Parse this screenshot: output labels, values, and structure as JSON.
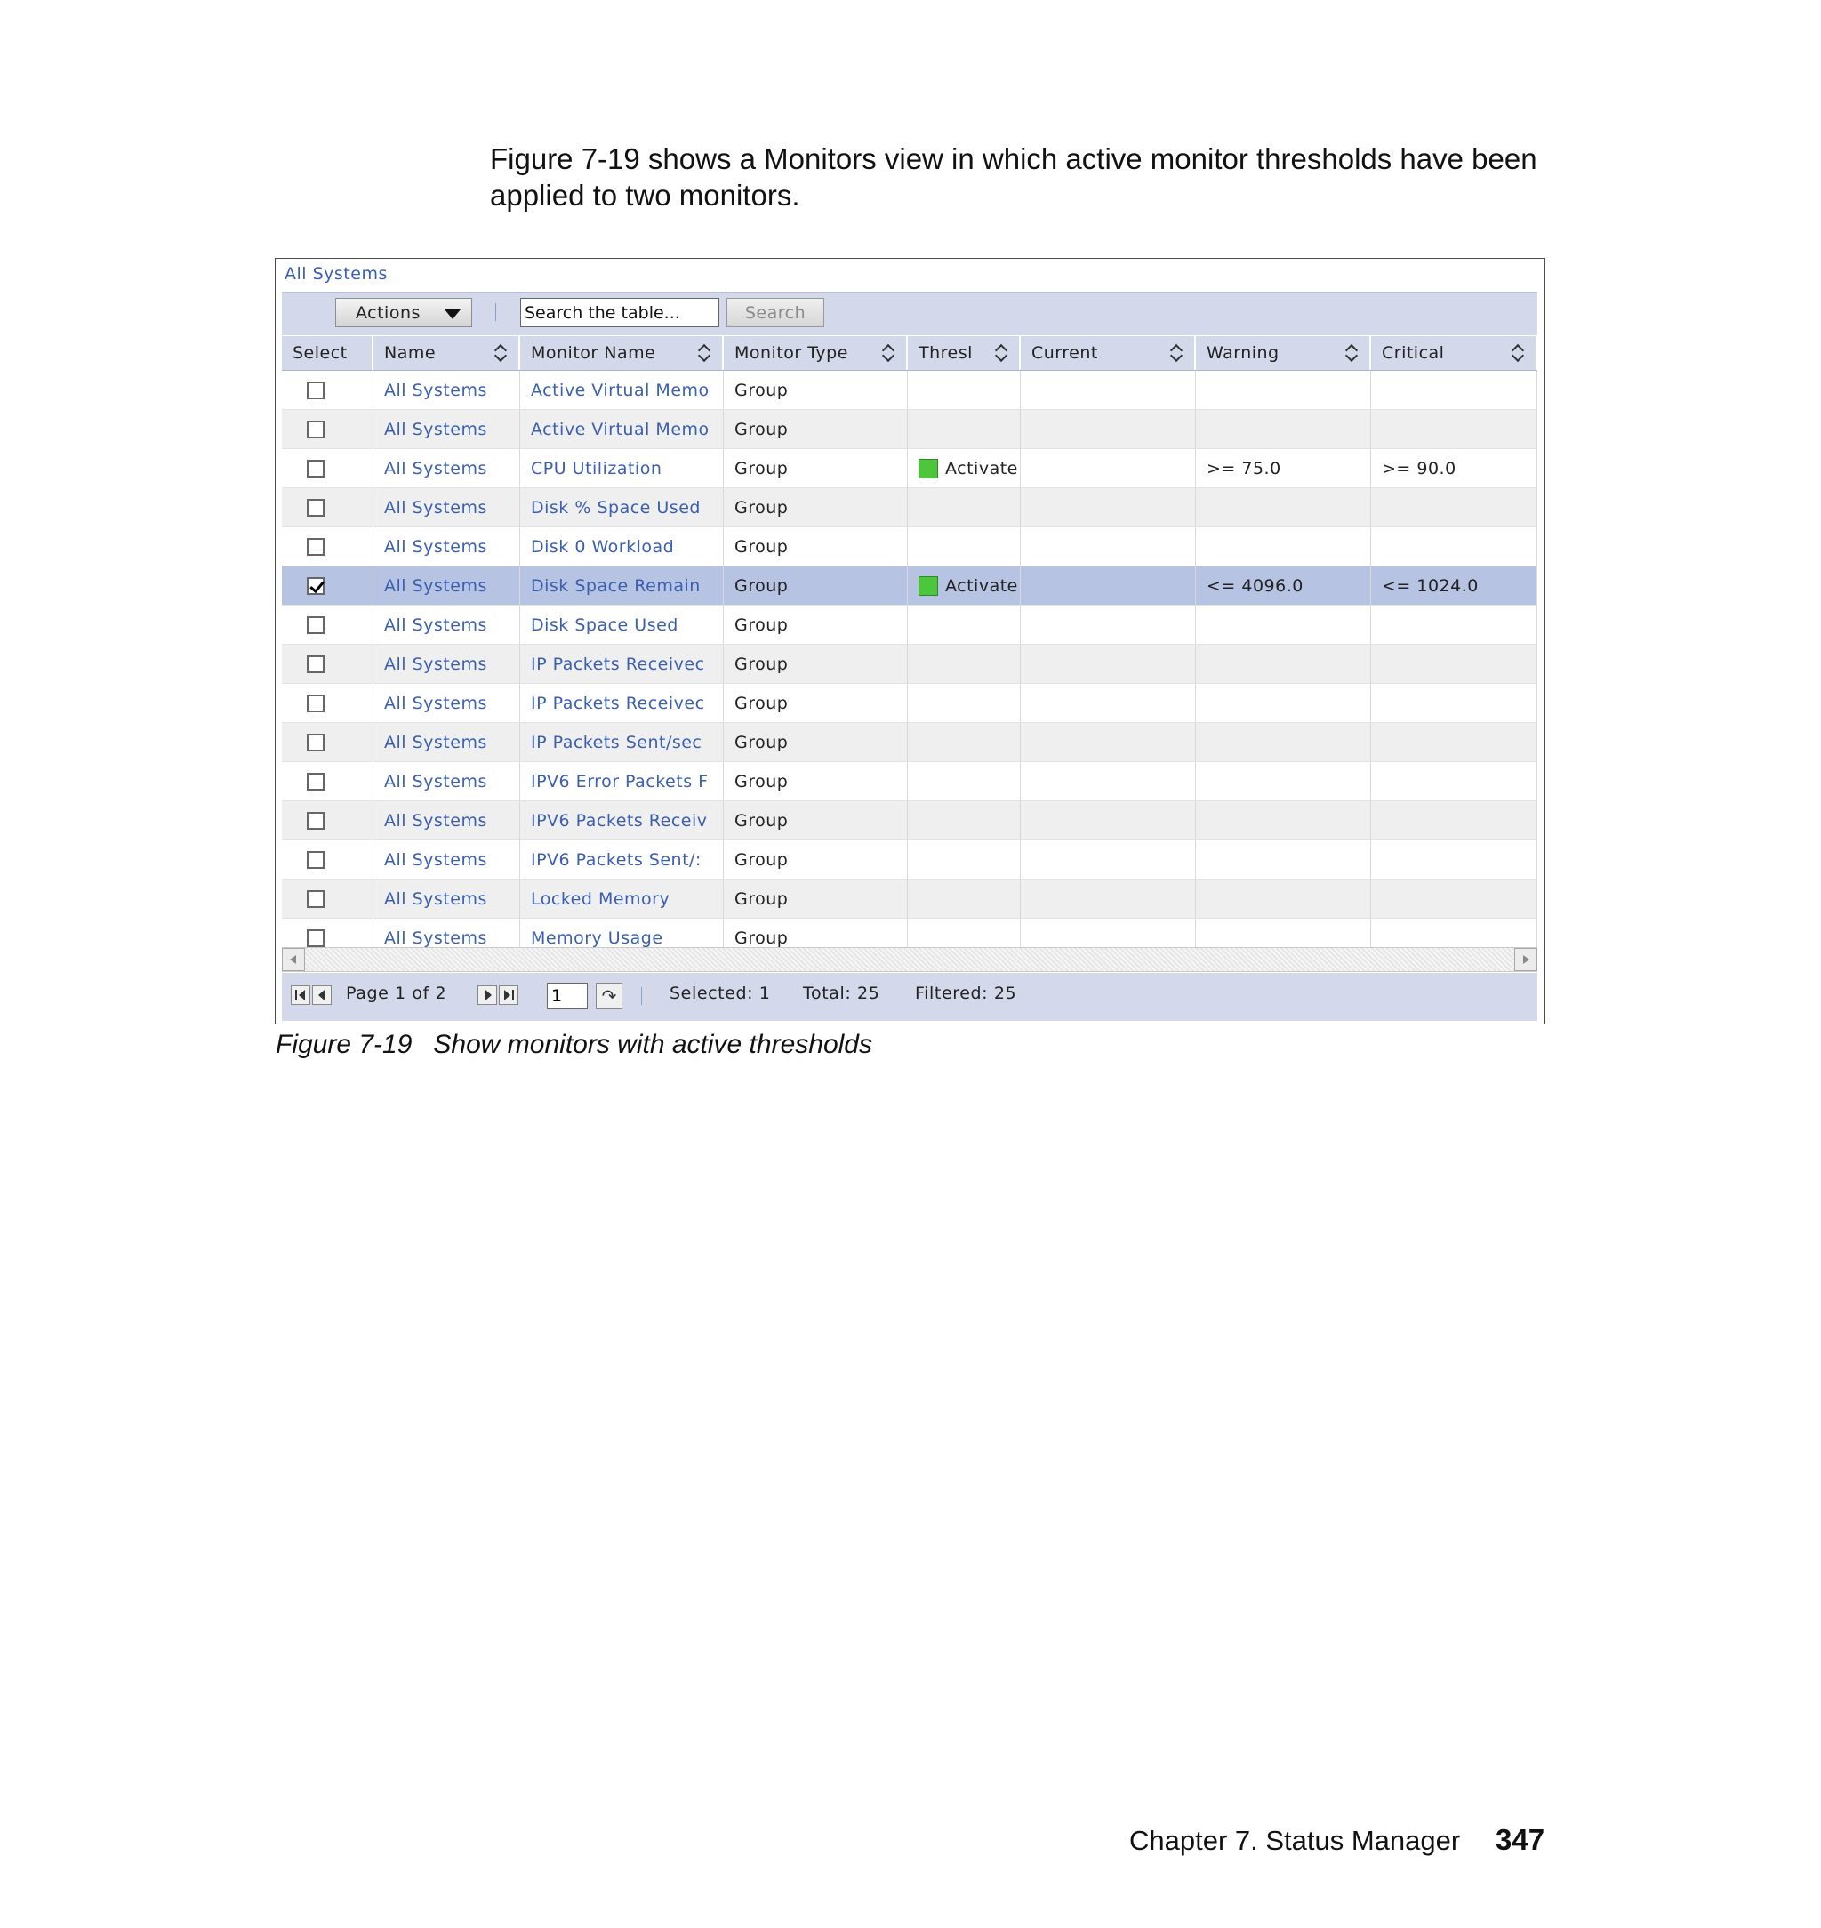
{
  "intro_text": "Figure 7-19 shows a Monitors view in which active monitor thresholds have been applied to two monitors.",
  "breadcrumb": "All Systems",
  "toolbar": {
    "actions_label": "Actions",
    "search_placeholder": "Search the table...",
    "search_button": "Search"
  },
  "columns": [
    "Select",
    "Name",
    "Monitor Name",
    "Monitor Type",
    "Thresl",
    "Current",
    "Warning",
    "Critical"
  ],
  "rows": [
    {
      "checked": false,
      "name": "All Systems",
      "monitor": "Active Virtual Memo",
      "type": "Group",
      "threshold": "",
      "current": "",
      "warning": "",
      "critical": ""
    },
    {
      "checked": false,
      "name": "All Systems",
      "monitor": "Active Virtual Memo",
      "type": "Group",
      "threshold": "",
      "current": "",
      "warning": "",
      "critical": ""
    },
    {
      "checked": false,
      "name": "All Systems",
      "monitor": "CPU Utilization",
      "type": "Group",
      "threshold": "Activate",
      "current": "",
      "warning": ">= 75.0",
      "critical": ">= 90.0"
    },
    {
      "checked": false,
      "name": "All Systems",
      "monitor": "Disk % Space Used",
      "type": "Group",
      "threshold": "",
      "current": "",
      "warning": "",
      "critical": ""
    },
    {
      "checked": false,
      "name": "All Systems",
      "monitor": "Disk 0 Workload",
      "type": "Group",
      "threshold": "",
      "current": "",
      "warning": "",
      "critical": ""
    },
    {
      "checked": true,
      "name": "All Systems",
      "monitor": "Disk Space Remain",
      "type": "Group",
      "threshold": "Activate",
      "current": "",
      "warning": "<= 4096.0",
      "critical": "<= 1024.0"
    },
    {
      "checked": false,
      "name": "All Systems",
      "monitor": "Disk Space Used",
      "type": "Group",
      "threshold": "",
      "current": "",
      "warning": "",
      "critical": ""
    },
    {
      "checked": false,
      "name": "All Systems",
      "monitor": "IP Packets Receivec",
      "type": "Group",
      "threshold": "",
      "current": "",
      "warning": "",
      "critical": ""
    },
    {
      "checked": false,
      "name": "All Systems",
      "monitor": "IP Packets Receivec",
      "type": "Group",
      "threshold": "",
      "current": "",
      "warning": "",
      "critical": ""
    },
    {
      "checked": false,
      "name": "All Systems",
      "monitor": "IP Packets Sent/sec",
      "type": "Group",
      "threshold": "",
      "current": "",
      "warning": "",
      "critical": ""
    },
    {
      "checked": false,
      "name": "All Systems",
      "monitor": "IPV6 Error Packets F",
      "type": "Group",
      "threshold": "",
      "current": "",
      "warning": "",
      "critical": ""
    },
    {
      "checked": false,
      "name": "All Systems",
      "monitor": "IPV6 Packets Receiv",
      "type": "Group",
      "threshold": "",
      "current": "",
      "warning": "",
      "critical": ""
    },
    {
      "checked": false,
      "name": "All Systems",
      "monitor": "IPV6 Packets Sent/:",
      "type": "Group",
      "threshold": "",
      "current": "",
      "warning": "",
      "critical": ""
    },
    {
      "checked": false,
      "name": "All Systems",
      "monitor": "Locked Memory",
      "type": "Group",
      "threshold": "",
      "current": "",
      "warning": "",
      "critical": ""
    },
    {
      "checked": false,
      "name": "All Systems",
      "monitor": "Memory Usage",
      "type": "Group",
      "threshold": "",
      "current": "",
      "warning": "",
      "critical": ""
    }
  ],
  "pagination": {
    "page_label": "Page 1 of 2",
    "page_value": "1",
    "selected": "Selected: 1",
    "total": "Total: 25",
    "filtered": "Filtered: 25"
  },
  "caption": {
    "number": "Figure 7-19",
    "text": "Show monitors with active thresholds"
  },
  "page_footer": {
    "chapter": "Chapter 7. Status Manager",
    "page": "347"
  },
  "colors": {
    "accent_link": "#3a5fb0",
    "toolbar_bg": "#d3d8ea",
    "selected_row": "#b7c3e2",
    "status_green": "#4cc63a"
  },
  "icons": [
    "dropdown-caret-icon",
    "sort-icon",
    "checkbox-icon",
    "green-status-icon",
    "first-page-icon",
    "prev-page-icon",
    "next-page-icon",
    "last-page-icon",
    "go-arrow-icon",
    "scroll-left-icon",
    "scroll-right-icon"
  ]
}
